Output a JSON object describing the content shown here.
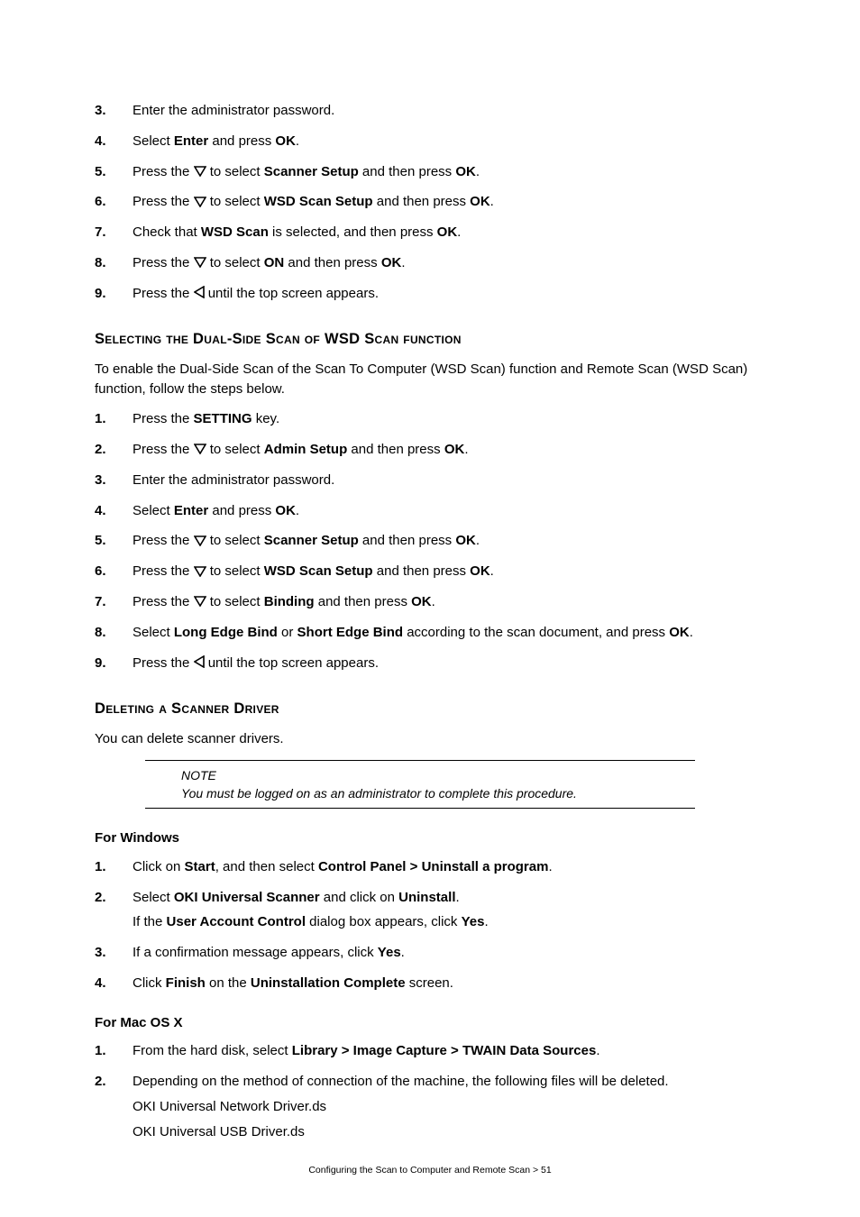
{
  "list_a": [
    {
      "num": "3.",
      "body": [
        {
          "runs": [
            {
              "t": "Enter the administrator password."
            }
          ]
        }
      ]
    },
    {
      "num": "4.",
      "body": [
        {
          "runs": [
            {
              "t": "Select "
            },
            {
              "t": "Enter",
              "b": true
            },
            {
              "t": " and press "
            },
            {
              "t": "OK",
              "b": true
            },
            {
              "t": "."
            }
          ]
        }
      ]
    },
    {
      "num": "5.",
      "body": [
        {
          "runs": [
            {
              "t": "Press the "
            },
            {
              "icon": "down"
            },
            {
              "t": " to select "
            },
            {
              "t": "Scanner Setup",
              "b": true
            },
            {
              "t": " and then press "
            },
            {
              "t": "OK",
              "b": true
            },
            {
              "t": "."
            }
          ]
        }
      ]
    },
    {
      "num": "6.",
      "body": [
        {
          "runs": [
            {
              "t": "Press the "
            },
            {
              "icon": "down"
            },
            {
              "t": " to select "
            },
            {
              "t": "WSD Scan Setup",
              "b": true
            },
            {
              "t": " and then press "
            },
            {
              "t": "OK",
              "b": true
            },
            {
              "t": "."
            }
          ]
        }
      ]
    },
    {
      "num": "7.",
      "body": [
        {
          "runs": [
            {
              "t": "Check that "
            },
            {
              "t": "WSD Scan",
              "b": true
            },
            {
              "t": " is selected, and then press "
            },
            {
              "t": "OK",
              "b": true
            },
            {
              "t": "."
            }
          ]
        }
      ]
    },
    {
      "num": "8.",
      "body": [
        {
          "runs": [
            {
              "t": "Press the "
            },
            {
              "icon": "down"
            },
            {
              "t": " to select "
            },
            {
              "t": "ON",
              "b": true
            },
            {
              "t": " and then press "
            },
            {
              "t": "OK",
              "b": true
            },
            {
              "t": "."
            }
          ]
        }
      ]
    },
    {
      "num": "9.",
      "body": [
        {
          "runs": [
            {
              "t": "Press the "
            },
            {
              "icon": "left"
            },
            {
              "t": " until the top screen appears."
            }
          ]
        }
      ]
    }
  ],
  "heading_dual": "Selecting the Dual-Side Scan of WSD Scan function",
  "para_dual": "To enable the Dual-Side Scan of the Scan To Computer (WSD Scan) function and Remote Scan (WSD Scan) function, follow the steps below.",
  "list_b": [
    {
      "num": "1.",
      "body": [
        {
          "runs": [
            {
              "t": "Press the "
            },
            {
              "t": "SETTING",
              "b": true
            },
            {
              "t": " key."
            }
          ]
        }
      ]
    },
    {
      "num": "2.",
      "body": [
        {
          "runs": [
            {
              "t": "Press the "
            },
            {
              "icon": "down"
            },
            {
              "t": " to select "
            },
            {
              "t": "Admin Setup",
              "b": true
            },
            {
              "t": " and then press "
            },
            {
              "t": "OK",
              "b": true
            },
            {
              "t": "."
            }
          ]
        }
      ]
    },
    {
      "num": "3.",
      "body": [
        {
          "runs": [
            {
              "t": "Enter the administrator password."
            }
          ]
        }
      ]
    },
    {
      "num": "4.",
      "body": [
        {
          "runs": [
            {
              "t": "Select "
            },
            {
              "t": "Enter",
              "b": true
            },
            {
              "t": " and press "
            },
            {
              "t": "OK",
              "b": true
            },
            {
              "t": "."
            }
          ]
        }
      ]
    },
    {
      "num": "5.",
      "body": [
        {
          "runs": [
            {
              "t": "Press the "
            },
            {
              "icon": "down"
            },
            {
              "t": " to select "
            },
            {
              "t": "Scanner Setup",
              "b": true
            },
            {
              "t": " and then press "
            },
            {
              "t": "OK",
              "b": true
            },
            {
              "t": "."
            }
          ]
        }
      ]
    },
    {
      "num": "6.",
      "body": [
        {
          "runs": [
            {
              "t": "Press the "
            },
            {
              "icon": "down"
            },
            {
              "t": " to select "
            },
            {
              "t": "WSD Scan Setup",
              "b": true
            },
            {
              "t": " and then press "
            },
            {
              "t": "OK",
              "b": true
            },
            {
              "t": "."
            }
          ]
        }
      ]
    },
    {
      "num": "7.",
      "body": [
        {
          "runs": [
            {
              "t": "Press the "
            },
            {
              "icon": "down"
            },
            {
              "t": " to select "
            },
            {
              "t": "Binding",
              "b": true
            },
            {
              "t": " and then press "
            },
            {
              "t": "OK",
              "b": true
            },
            {
              "t": "."
            }
          ]
        }
      ]
    },
    {
      "num": "8.",
      "body": [
        {
          "runs": [
            {
              "t": "Select "
            },
            {
              "t": "Long Edge Bind",
              "b": true
            },
            {
              "t": " or "
            },
            {
              "t": "Short Edge Bind",
              "b": true
            },
            {
              "t": " according to the scan document, and press "
            },
            {
              "t": "OK",
              "b": true
            },
            {
              "t": "."
            }
          ]
        }
      ]
    },
    {
      "num": "9.",
      "body": [
        {
          "runs": [
            {
              "t": "Press the "
            },
            {
              "icon": "left"
            },
            {
              "t": " until the top screen appears."
            }
          ]
        }
      ]
    }
  ],
  "heading_delete": "Deleting a Scanner Driver",
  "para_delete": "You can delete scanner drivers.",
  "note": {
    "title": "NOTE",
    "text": "You must be logged on as an administrator to complete this procedure."
  },
  "heading_win": "For Windows",
  "list_win": [
    {
      "num": "1.",
      "body": [
        {
          "runs": [
            {
              "t": "Click on "
            },
            {
              "t": "Start",
              "b": true
            },
            {
              "t": ", and then select "
            },
            {
              "t": "Control Panel > Uninstall a program",
              "b": true
            },
            {
              "t": "."
            }
          ]
        }
      ]
    },
    {
      "num": "2.",
      "body": [
        {
          "runs": [
            {
              "t": "Select "
            },
            {
              "t": "OKI Universal Scanner",
              "b": true
            },
            {
              "t": " and click on "
            },
            {
              "t": "Uninstall",
              "b": true
            },
            {
              "t": "."
            }
          ]
        },
        {
          "runs": [
            {
              "t": "If the "
            },
            {
              "t": "User Account Control",
              "b": true
            },
            {
              "t": " dialog box appears, click "
            },
            {
              "t": "Yes",
              "b": true
            },
            {
              "t": "."
            }
          ]
        }
      ]
    },
    {
      "num": "3.",
      "body": [
        {
          "runs": [
            {
              "t": "If a confirmation message appears, click "
            },
            {
              "t": "Yes",
              "b": true
            },
            {
              "t": "."
            }
          ]
        }
      ]
    },
    {
      "num": "4.",
      "body": [
        {
          "runs": [
            {
              "t": "Click "
            },
            {
              "t": "Finish",
              "b": true
            },
            {
              "t": " on the "
            },
            {
              "t": "Uninstallation Complete",
              "b": true
            },
            {
              "t": " screen."
            }
          ]
        }
      ]
    }
  ],
  "heading_mac": "For Mac OS X",
  "list_mac": [
    {
      "num": "1.",
      "body": [
        {
          "runs": [
            {
              "t": "From the hard disk, select "
            },
            {
              "t": "Library > Image Capture > TWAIN Data Sources",
              "b": true
            },
            {
              "t": "."
            }
          ]
        }
      ]
    },
    {
      "num": "2.",
      "body": [
        {
          "runs": [
            {
              "t": "Depending on the method of connection of the machine, the following files will be deleted."
            }
          ]
        },
        {
          "runs": [
            {
              "t": "OKI Universal Network Driver.ds"
            }
          ]
        },
        {
          "runs": [
            {
              "t": "OKI Universal USB Driver.ds"
            }
          ]
        }
      ]
    }
  ],
  "footer": "Configuring the Scan to Computer and Remote Scan > 51"
}
